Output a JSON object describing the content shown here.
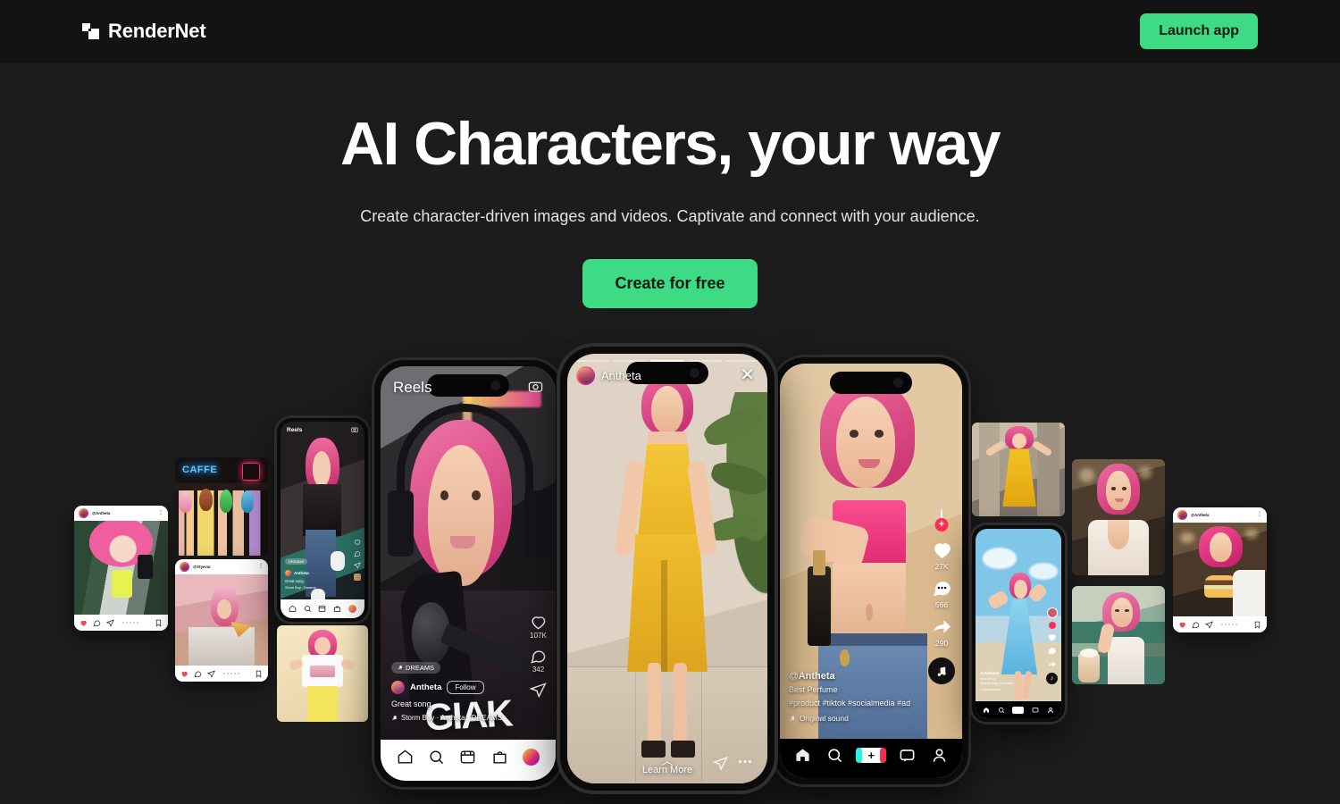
{
  "header": {
    "brand_name": "RenderNet",
    "logo_icon": "overlapping-squares-icon",
    "launch_label": "Launch app",
    "accent_color": "#3ddc84",
    "background_color": "#131313"
  },
  "hero": {
    "title": "AI Characters, your way",
    "subtitle": "Create character-driven images and videos. Captivate and connect with your audience.",
    "cta_label": "Create for free",
    "background_color": "#1c1c1c"
  },
  "gallery": {
    "instagram_story_phone": {
      "username": "Antheta",
      "close_icon": "close-icon",
      "learn_more_label": "Learn More",
      "chevron_icon": "chevron-up-icon",
      "send_icon": "paper-plane-icon",
      "more_icon": "ellipsis-icon",
      "story_segments": 5,
      "active_segment": 3
    },
    "reels_phone": {
      "title": "Reels",
      "camera_icon": "camera-icon",
      "tag_label": "DREAMS",
      "username": "Antheta",
      "follow_label": "Follow",
      "caption": "Great song",
      "song_label": "Storm Boy · Antheta · DREAMS",
      "like_count": "107K",
      "comment_count": "342",
      "share_icon": "paper-plane-icon",
      "heart_icon": "heart-icon",
      "comment_icon": "comment-icon",
      "nav_items": [
        "home-icon",
        "search-icon",
        "reels-icon",
        "shop-icon",
        "profile-icon"
      ]
    },
    "tiktok_phone": {
      "username": "@Antheta",
      "description": "Best Perfume",
      "hashtags": "#product #tiktok #socialmedia #ad",
      "sound_label": "Original sound",
      "music_icon": "music-note-icon",
      "like_count": "27K",
      "comment_count": "566",
      "share_count": "290",
      "heart_icon": "heart-icon",
      "comment_icon": "comment-icon",
      "share_icon": "share-arrow-icon",
      "disc_icon": "tiktok-note-icon",
      "follow_plus_icon": "plus-icon",
      "nav_items": [
        "home-icon",
        "search-icon",
        "add-icon",
        "inbox-icon",
        "profile-icon"
      ]
    },
    "small_reels_card": {
      "title": "Reels",
      "camera_icon": "camera-icon",
      "username": "Antheta",
      "caption": "Great song",
      "song_label": "Storm Boy · Dreams"
    },
    "small_tiktok_card": {
      "username": "@Antheta",
      "description": "Best Song",
      "hashtags": "#dance #fyp #summer",
      "sound_label": "Original sound"
    },
    "instagram_cards": [
      {
        "username": "@Antheta",
        "alt": "pink-hair-mirror-selfie-green-top"
      },
      {
        "username": "@Styevar",
        "alt": "pink-hair-holding-pizza-slice"
      },
      {
        "username": "@Antheta",
        "alt": "pink-hair-holding-burger"
      }
    ],
    "photo_cards": [
      {
        "alt": "four-women-caffe-neon-sign"
      },
      {
        "alt": "pink-hair-white-tee-yellow-pants"
      },
      {
        "alt": "yellow-dress-peace-sign-street"
      },
      {
        "alt": "blue-dress-beach-dance"
      },
      {
        "alt": "white-tank-cafe-portrait"
      },
      {
        "alt": "cafe-iced-coffee-portrait"
      }
    ]
  }
}
